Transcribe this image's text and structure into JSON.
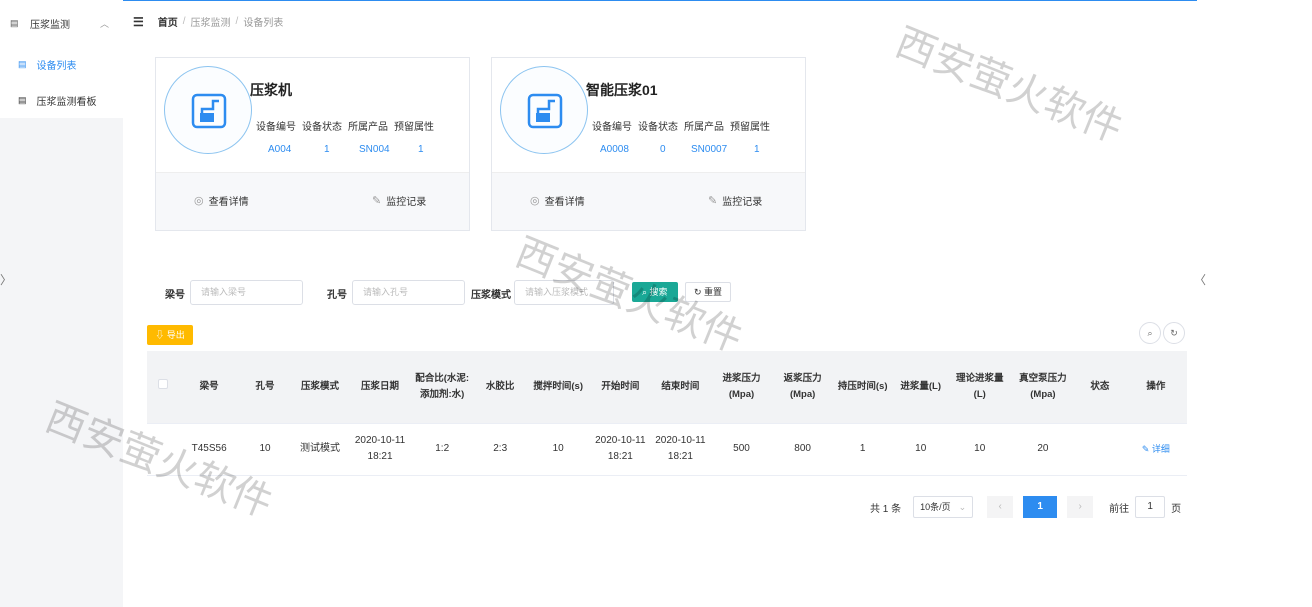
{
  "sidebar": {
    "group_label": "压浆监测",
    "items": [
      {
        "label": "设备列表",
        "active": true
      },
      {
        "label": "压浆监测看板",
        "active": false
      }
    ]
  },
  "breadcrumb": {
    "home": "首页",
    "level1": "压浆监测",
    "level2": "设备列表",
    "separator": "/"
  },
  "devices": [
    {
      "name": "压浆机",
      "labels": [
        "设备编号",
        "设备状态",
        "所属产品",
        "预留属性"
      ],
      "values": [
        "A004",
        "1",
        "SN004",
        "1"
      ],
      "view_label": "查看详情",
      "record_label": "监控记录"
    },
    {
      "name": "智能压浆01",
      "labels": [
        "设备编号",
        "设备状态",
        "所属产品",
        "预留属性"
      ],
      "values": [
        "A0008",
        "0",
        "SN0007",
        "1"
      ],
      "view_label": "查看详情",
      "record_label": "监控记录"
    }
  ],
  "filters": {
    "beam_label": "梁号",
    "beam_placeholder": "请输入梁号",
    "hole_label": "孔号",
    "hole_placeholder": "请输入孔号",
    "mode_label": "压浆模式",
    "mode_placeholder": "请输入压浆模式",
    "search_label": "搜索",
    "reset_label": "重置"
  },
  "toolbar": {
    "export_label": "导出"
  },
  "table": {
    "headers": [
      "梁号",
      "孔号",
      "压浆模式",
      "压浆日期",
      "配合比(水泥:添加剂:水)",
      "水胶比",
      "搅拌时间(s)",
      "开始时间",
      "结束时间",
      "进浆压力(Mpa)",
      "返浆压力(Mpa)",
      "持压时间(s)",
      "进浆量(L)",
      "理论进浆量(L)",
      "真空泵压力(Mpa)",
      "状态",
      "操作"
    ],
    "rows": [
      {
        "beam": "T45S56",
        "hole": "10",
        "mode": "测试模式",
        "date": "2020-10-11 18:21",
        "ratio": "1:2",
        "wb_ratio": "2:3",
        "mix_time": "10",
        "start": "2020-10-11 18:21",
        "end": "2020-10-11 18:21",
        "in_pressure": "500",
        "return_pressure": "800",
        "hold_time": "1",
        "volume": "10",
        "theory_volume": "10",
        "vacuum": "20",
        "status": "",
        "action": "详细"
      }
    ]
  },
  "pagination": {
    "total": "共 1 条",
    "page_size": "10条/页",
    "current": "1",
    "goto_label": "前往",
    "goto_value": "1",
    "page_unit": "页"
  },
  "watermark": "西安萤火软件",
  "colors": {
    "primary": "#2d8cf0",
    "search": "#1aa896",
    "export": "#ffba00"
  }
}
